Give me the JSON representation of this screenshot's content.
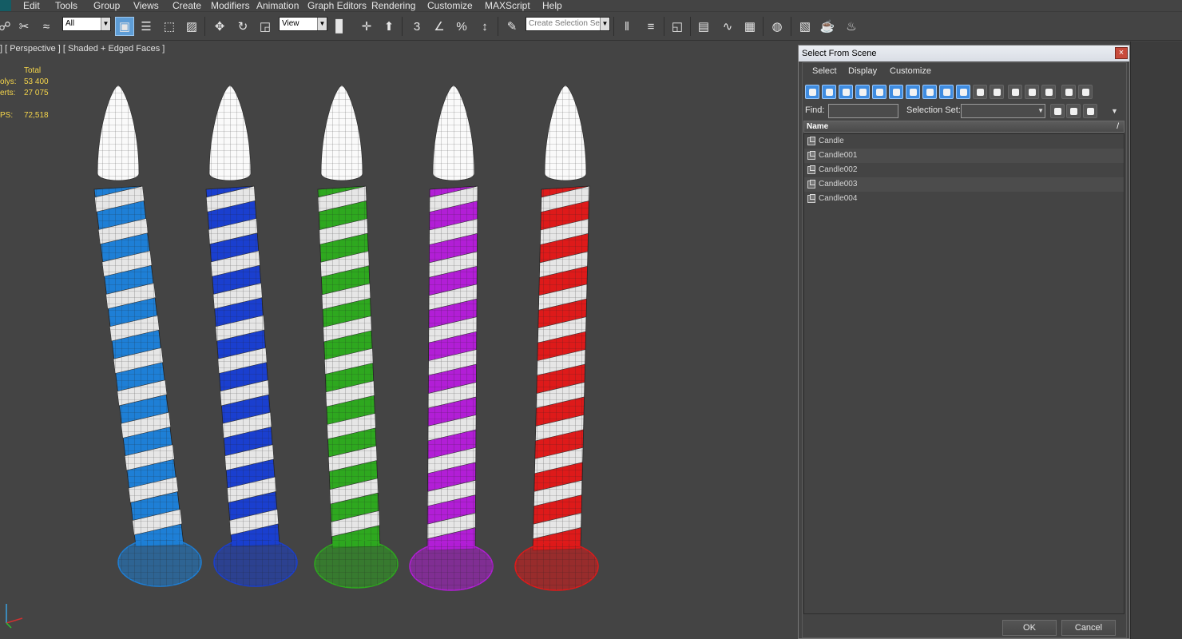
{
  "menubar": {
    "items": [
      "Edit",
      "Tools",
      "Group",
      "Views",
      "Create",
      "Modifiers",
      "Animation",
      "Graph Editors",
      "Rendering",
      "Customize",
      "MAXScript",
      "Help"
    ]
  },
  "toolbar": {
    "selection_filter": "All",
    "reference_coordinate": "View",
    "named_selection_set": "Create Selection Se",
    "snap_label": "3"
  },
  "viewport": {
    "label": "] [ Perspective ] [ Shaded + Edged Faces ]",
    "stats": {
      "header": "Total",
      "rows": [
        {
          "key": "olys:",
          "value": "53 400"
        },
        {
          "key": "erts:",
          "value": "27 075"
        },
        {
          "key": "PS:",
          "value": "72,518"
        }
      ]
    },
    "candles": [
      {
        "name": "Candle",
        "color": "#1e7fd6"
      },
      {
        "name": "Candle001",
        "color": "#1a3fcf"
      },
      {
        "name": "Candle002",
        "color": "#2ea81f"
      },
      {
        "name": "Candle003",
        "color": "#b21ed6"
      },
      {
        "name": "Candle004",
        "color": "#de1a1a"
      }
    ]
  },
  "dialog": {
    "title": "Select From Scene",
    "close": "×",
    "menu": [
      "Select",
      "Display",
      "Customize"
    ],
    "find_label": "Find:",
    "find_value": "",
    "selection_set_label": "Selection Set:",
    "selection_set_value": "",
    "column_header": "Name",
    "sort_indicator": "/",
    "objects": [
      "Candle",
      "Candle001",
      "Candle002",
      "Candle003",
      "Candle004"
    ],
    "ok_label": "OK",
    "cancel_label": "Cancel"
  }
}
